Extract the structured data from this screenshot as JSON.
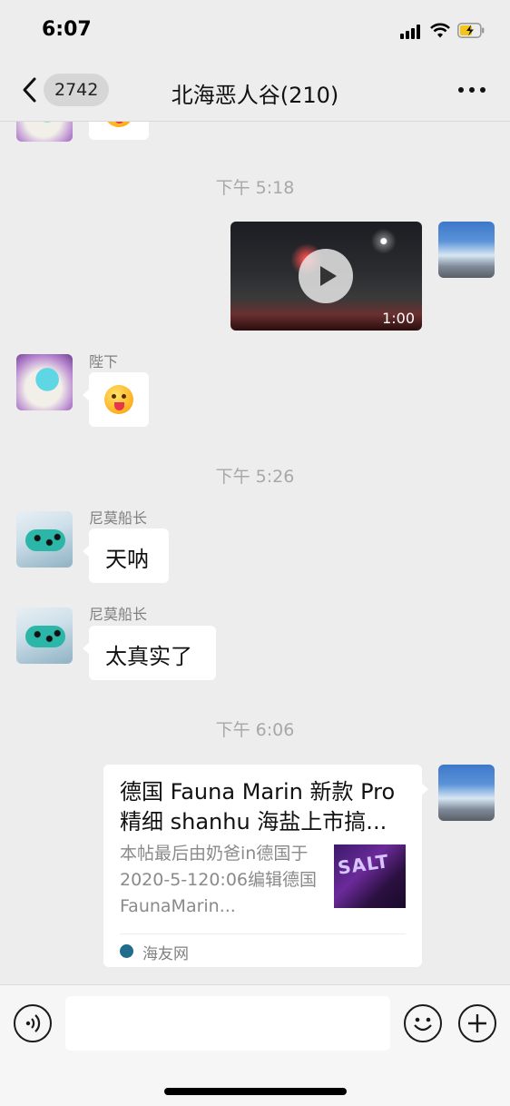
{
  "status_bar": {
    "time": "6:07"
  },
  "nav": {
    "back_count": "2742",
    "title": "北海恶人谷(210)",
    "more_icon": "more-icon"
  },
  "messages": {
    "ts1": "下午 5:18",
    "video_duration": "1:00",
    "sender_bixia": "陛下",
    "ts2": "下午 5:26",
    "sender_nemo_1": "尼莫船长",
    "text_1": "天呐",
    "sender_nemo_2": "尼莫船长",
    "text_2": "太真实了",
    "ts3": "下午 6:06"
  },
  "link_card": {
    "title": "德国 Fauna Marin 新款 Pro 精细 shanhu 海盐上市搞...",
    "description": "本帖最后由奶爸in德国于2020-5-120:06编辑德国 FaunaMarin...",
    "thumb_text": "SALT",
    "source": "海友网"
  },
  "colors": {
    "background": "#ededed",
    "bubble": "#ffffff",
    "timestamp": "#a8a8a8"
  }
}
